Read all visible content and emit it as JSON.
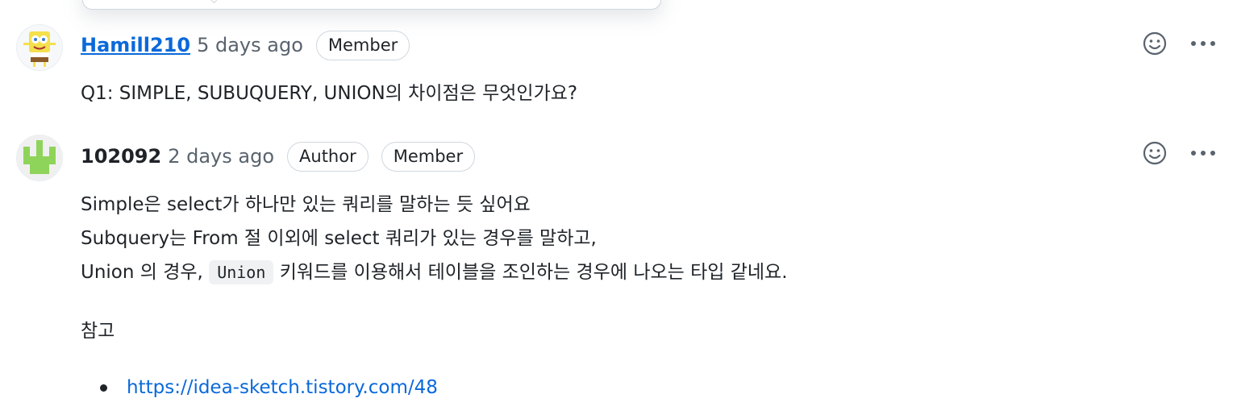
{
  "comments": [
    {
      "author": "Hamill210",
      "time": "5 days ago",
      "badges": [
        "Member"
      ],
      "body": [
        "Q1: SIMPLE, SUBUQUERY, UNION의 차이점은 무엇인가요?"
      ]
    },
    {
      "author": "102092",
      "time": "2 days ago",
      "badges": [
        "Author",
        "Member"
      ],
      "body": [
        "Simple은 select가 하나만 있는 쿼리를 말하는 듯 싶어요",
        "Subquery는 From 절 이외에 select 쿼리가 있는 경우를 말하고,"
      ],
      "line3_before": "Union 의 경우,",
      "line3_code": "Union",
      "line3_after": "키워드를 이용해서 테이블을 조인하는 경우에 나오는 타입 같네요.",
      "ref_label": "참고",
      "links": [
        "https://idea-sketch.tistory.com/48"
      ]
    }
  ],
  "icons": {
    "reaction": "smiley-icon",
    "more": "kebab-horizontal-icon"
  },
  "colors": {
    "link": "#0969da",
    "muted": "#59636e",
    "border": "#d0d7de"
  }
}
